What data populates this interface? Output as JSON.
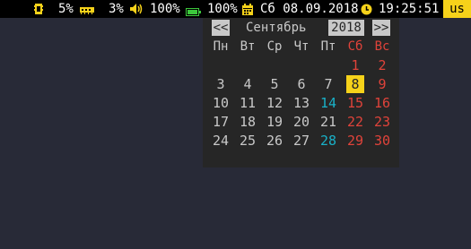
{
  "statusbar": {
    "cpu": "5%",
    "mem": "3%",
    "volume": "100%",
    "battery": "100%",
    "date": "Сб 08.09.2018",
    "time": "19:25:51",
    "layout": "us"
  },
  "colors": {
    "accent": "#f6d21a",
    "weekend": "#e0433a",
    "highlight": "#19b1c8",
    "battery": "#3cc83c"
  },
  "calendar": {
    "prev": "<<",
    "next": ">>",
    "month": "Сентябрь",
    "year": "2018",
    "weekdays": [
      "Пн",
      "Вт",
      "Ср",
      "Чт",
      "Пт",
      "Сб",
      "Вс"
    ],
    "weeks": [
      [
        "",
        "",
        "",
        "",
        "",
        "1",
        "2"
      ],
      [
        "3",
        "4",
        "5",
        "6",
        "7",
        "8",
        "9"
      ],
      [
        "10",
        "11",
        "12",
        "13",
        "14",
        "15",
        "16"
      ],
      [
        "17",
        "18",
        "19",
        "20",
        "21",
        "22",
        "23"
      ],
      [
        "24",
        "25",
        "26",
        "27",
        "28",
        "29",
        "30"
      ]
    ],
    "today": "8",
    "highlighted": [
      "14",
      "28"
    ]
  }
}
